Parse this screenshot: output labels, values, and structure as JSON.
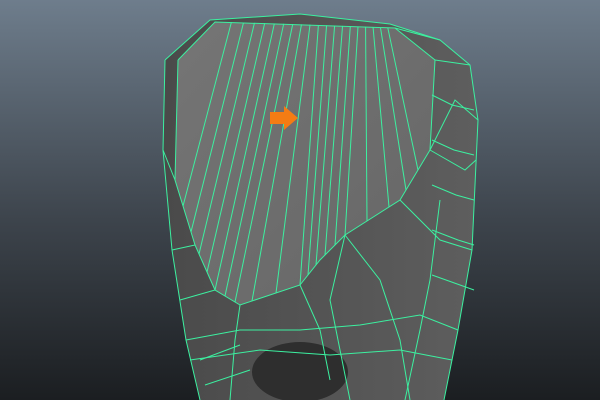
{
  "viewport": {
    "background_top": "#6e7d8c",
    "background_bottom": "#1b1e21",
    "mesh_face_color": "#6f6f6f",
    "mesh_side_color": "#535353",
    "wireframe_color": "#3cf0a0",
    "selection": "mesh-object"
  },
  "annotation": {
    "icon": "arrow-right-icon",
    "color": "#f47c14"
  }
}
